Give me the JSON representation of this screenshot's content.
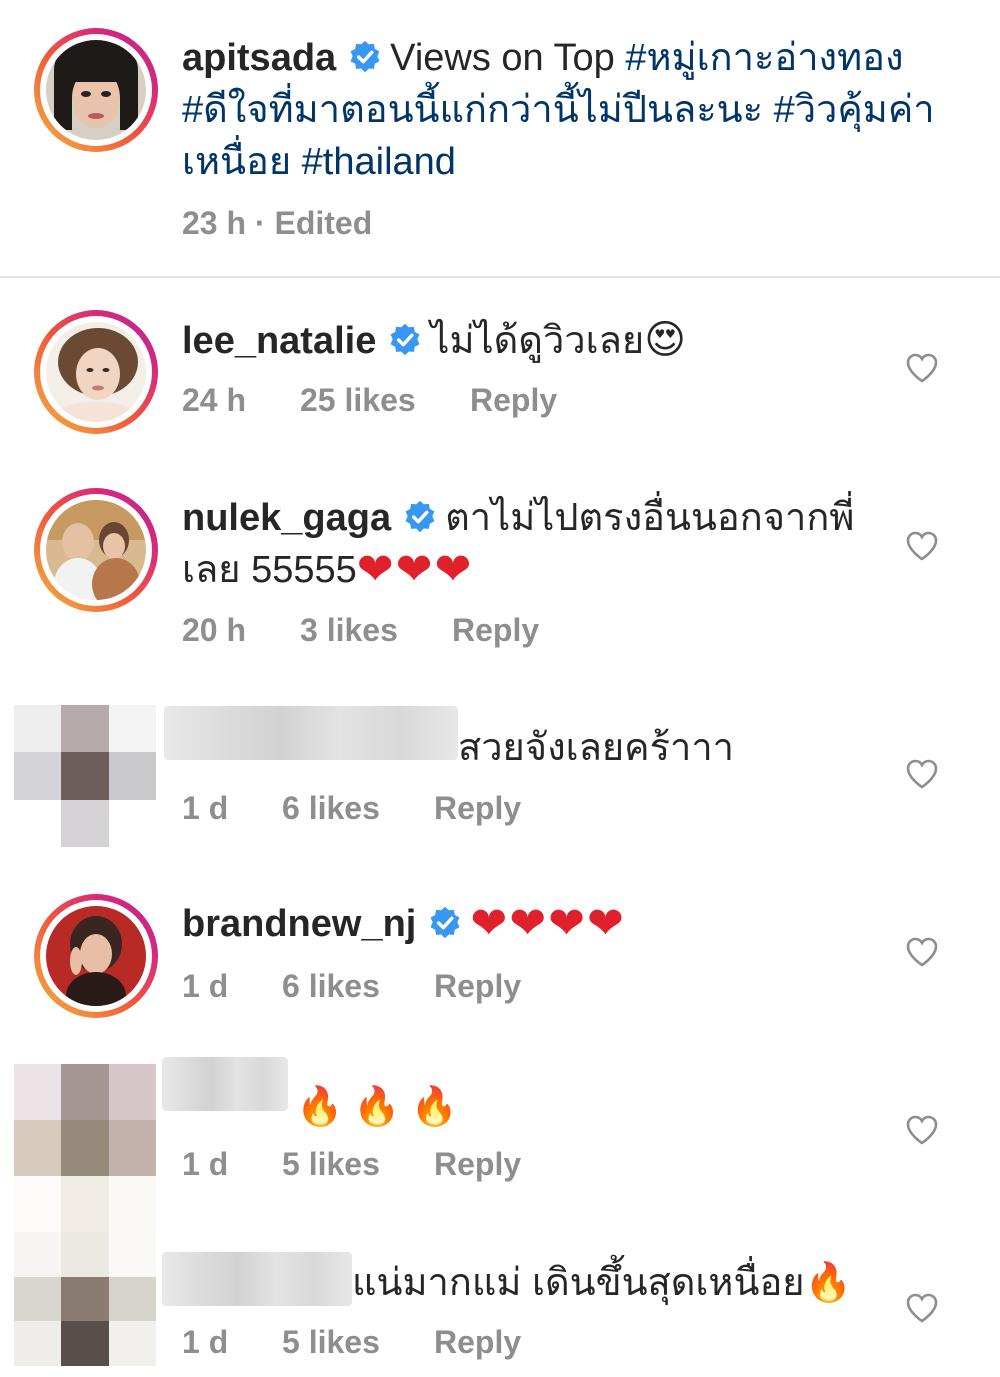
{
  "caption": {
    "username": "apitsada",
    "text_prefix": "Views on Top",
    "hashtags_line1": "#หมู่เกาะอ่างทอง",
    "hashtags_line2": "#ดีใจที่มาตอนนี้แก่กว่านี้ไม่ปีนละนะ #วิวคุ้มค่า",
    "hashtags_line3_prefix": "เหนื่อย",
    "hashtags_line3_tag": "#thailand",
    "time": "23 h",
    "edited": "· Edited"
  },
  "comments": [
    {
      "username": "lee_natalie",
      "text": "ไม่ได้ดูวิวเลย",
      "emoji": "😍",
      "time": "24 h",
      "likes": "25 likes",
      "reply": "Reply"
    },
    {
      "username": "nulek_gaga",
      "text_line1": "ตาไม่ไปตรงอื่นนอกจากพี่",
      "text_line2": "เลย 55555",
      "emoji": "❤❤❤",
      "time": "20 h",
      "likes": "3 likes",
      "reply": "Reply"
    },
    {
      "text": "สวยจังเลยคร้าาา",
      "time": "1 d",
      "likes": "6 likes",
      "reply": "Reply"
    },
    {
      "username": "brandnew_nj",
      "emoji": "❤❤❤❤",
      "time": "1 d",
      "likes": "6 likes",
      "reply": "Reply"
    },
    {
      "emoji": "🔥🔥🔥",
      "time": "1 d",
      "likes": "5 likes",
      "reply": "Reply"
    },
    {
      "text": "แน่มากแม่ เดินขึ้นสุดเหนื่อย",
      "emoji": "🔥",
      "time": "1 d",
      "likes": "5 likes",
      "reply": "Reply"
    }
  ],
  "colors": {
    "hashtag": "#003569",
    "verified": "#3897f0",
    "meta": "#8e8e8e",
    "heart_emoji": "#e0202a"
  },
  "icons": {
    "verified": "verified-badge-icon",
    "like": "heart-outline-icon"
  }
}
